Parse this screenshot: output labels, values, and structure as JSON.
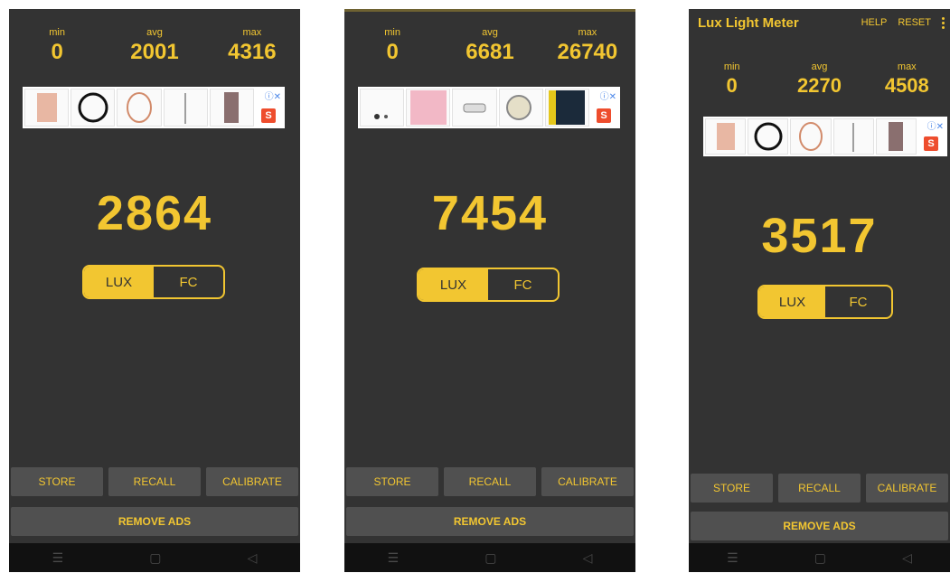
{
  "labels": {
    "min": "min",
    "avg": "avg",
    "max": "max",
    "lux": "LUX",
    "fc": "FC"
  },
  "buttons": {
    "store": "STORE",
    "recall": "RECALL",
    "calibrate": "CALIBRATE",
    "remove_ads": "REMOVE ADS"
  },
  "appbar": {
    "title": "Lux Light Meter",
    "help": "HELP",
    "reset": "RESET"
  },
  "icons": {
    "menu": "☰",
    "home": "▢",
    "back": "◁",
    "info": "ⓘ✕",
    "shop": "S"
  },
  "colors": {
    "accent": "#f2c631",
    "background": "#333333",
    "button": "#505050"
  },
  "screens": [
    {
      "min": "0",
      "avg": "2001",
      "max": "4316",
      "reading": "2864",
      "unit_selected": "LUX"
    },
    {
      "min": "0",
      "avg": "6681",
      "max": "26740",
      "reading": "7454",
      "unit_selected": "LUX"
    },
    {
      "min": "0",
      "avg": "2270",
      "max": "4508",
      "reading": "3517",
      "unit_selected": "LUX"
    }
  ]
}
